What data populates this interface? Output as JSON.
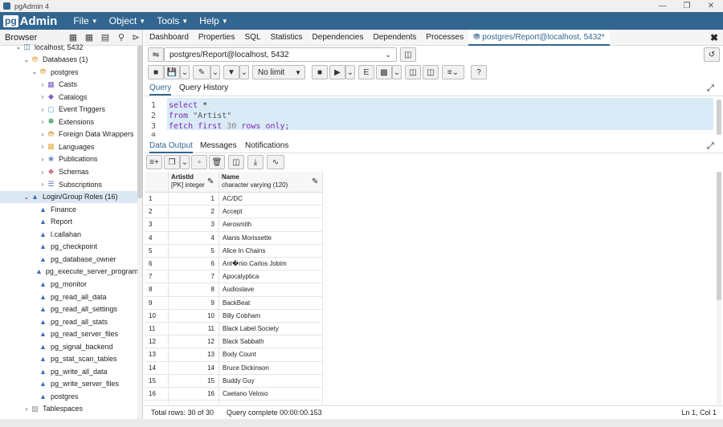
{
  "window": {
    "title": "pgAdmin 4"
  },
  "menubar": {
    "logo_pg": "pg",
    "logo_admin": "Admin",
    "items": [
      "File",
      "Object",
      "Tools",
      "Help"
    ]
  },
  "browser": {
    "label": "Browser"
  },
  "tree": [
    {
      "label": "localhost, 5432",
      "level": 0,
      "icon": "server-icon",
      "toggle": "v"
    },
    {
      "label": "Databases (1)",
      "level": 1,
      "icon": "databases-icon",
      "toggle": "v"
    },
    {
      "label": "postgres",
      "level": 2,
      "icon": "database-icon",
      "toggle": "v"
    },
    {
      "label": "Casts",
      "level": 3,
      "icon": "casts-icon",
      "toggle": ">"
    },
    {
      "label": "Catalogs",
      "level": 3,
      "icon": "catalogs-icon",
      "toggle": ">"
    },
    {
      "label": "Event Triggers",
      "level": 3,
      "icon": "event-triggers-icon",
      "toggle": ">"
    },
    {
      "label": "Extensions",
      "level": 3,
      "icon": "extensions-icon",
      "toggle": ">"
    },
    {
      "label": "Foreign Data Wrappers",
      "level": 3,
      "icon": "foreign-data-wrappers-icon",
      "toggle": ">"
    },
    {
      "label": "Languages",
      "level": 3,
      "icon": "languages-icon",
      "toggle": ">"
    },
    {
      "label": "Publications",
      "level": 3,
      "icon": "publications-icon",
      "toggle": ">"
    },
    {
      "label": "Schemas",
      "level": 3,
      "icon": "schemas-icon",
      "toggle": ">"
    },
    {
      "label": "Subscriptions",
      "level": 3,
      "icon": "subscriptions-icon",
      "toggle": ">"
    },
    {
      "label": "Login/Group Roles (16)",
      "level": 1,
      "icon": "roles-icon",
      "toggle": "v",
      "selected": true
    },
    {
      "label": "Finance",
      "level": 2,
      "icon": "role-icon",
      "toggle": ""
    },
    {
      "label": "Report",
      "level": 2,
      "icon": "role-icon",
      "toggle": ""
    },
    {
      "label": "l.callahan",
      "level": 2,
      "icon": "role-icon",
      "toggle": ""
    },
    {
      "label": "pg_checkpoint",
      "level": 2,
      "icon": "role-icon",
      "toggle": ""
    },
    {
      "label": "pg_database_owner",
      "level": 2,
      "icon": "role-icon",
      "toggle": ""
    },
    {
      "label": "pg_execute_server_program",
      "level": 2,
      "icon": "role-icon",
      "toggle": ""
    },
    {
      "label": "pg_monitor",
      "level": 2,
      "icon": "role-icon",
      "toggle": ""
    },
    {
      "label": "pg_read_all_data",
      "level": 2,
      "icon": "role-icon",
      "toggle": ""
    },
    {
      "label": "pg_read_all_settings",
      "level": 2,
      "icon": "role-icon",
      "toggle": ""
    },
    {
      "label": "pg_read_all_stats",
      "level": 2,
      "icon": "role-icon",
      "toggle": ""
    },
    {
      "label": "pg_read_server_files",
      "level": 2,
      "icon": "role-icon",
      "toggle": ""
    },
    {
      "label": "pg_signal_backend",
      "level": 2,
      "icon": "role-icon",
      "toggle": ""
    },
    {
      "label": "pg_stat_scan_tables",
      "level": 2,
      "icon": "role-icon",
      "toggle": ""
    },
    {
      "label": "pg_write_all_data",
      "level": 2,
      "icon": "role-icon",
      "toggle": ""
    },
    {
      "label": "pg_write_server_files",
      "level": 2,
      "icon": "role-icon",
      "toggle": ""
    },
    {
      "label": "postgres",
      "level": 2,
      "icon": "role-icon",
      "toggle": ""
    },
    {
      "label": "Tablespaces",
      "level": 1,
      "icon": "tablespaces-icon",
      "toggle": ">"
    }
  ],
  "main_tabs": [
    "Dashboard",
    "Properties",
    "SQL",
    "Statistics",
    "Dependencies",
    "Dependents",
    "Processes",
    "postgres/Report@localhost, 5432*"
  ],
  "connection": {
    "value": "postgres/Report@localhost, 5432"
  },
  "limit": {
    "value": "No limit"
  },
  "query_tabs": [
    "Query",
    "Query History"
  ],
  "editor": {
    "lines": [
      "select *",
      "from \"Artist\"",
      "fetch first 30 rows only;",
      ""
    ]
  },
  "result_tabs": [
    "Data Output",
    "Messages",
    "Notifications"
  ],
  "grid": {
    "columns": [
      {
        "name": "ArtistId",
        "type": "[PK] integer"
      },
      {
        "name": "Name",
        "type": "character varying (120)"
      }
    ],
    "rows": [
      {
        "n": "1",
        "id": "1",
        "name": "AC/DC"
      },
      {
        "n": "2",
        "id": "2",
        "name": "Accept"
      },
      {
        "n": "3",
        "id": "3",
        "name": "Aerosmith"
      },
      {
        "n": "4",
        "id": "4",
        "name": "Alanis Morissette"
      },
      {
        "n": "5",
        "id": "5",
        "name": "Alice In Chains"
      },
      {
        "n": "6",
        "id": "6",
        "name": "Ant�nio Carlos Jobim"
      },
      {
        "n": "7",
        "id": "7",
        "name": "Apocalyptica"
      },
      {
        "n": "8",
        "id": "8",
        "name": "Audioslave"
      },
      {
        "n": "9",
        "id": "9",
        "name": "BackBeat"
      },
      {
        "n": "10",
        "id": "10",
        "name": "Billy Cobham"
      },
      {
        "n": "11",
        "id": "11",
        "name": "Black Label Society"
      },
      {
        "n": "12",
        "id": "12",
        "name": "Black Sabbath"
      },
      {
        "n": "13",
        "id": "13",
        "name": "Body Count"
      },
      {
        "n": "14",
        "id": "14",
        "name": "Bruce Dickinson"
      },
      {
        "n": "15",
        "id": "15",
        "name": "Buddy Guy"
      },
      {
        "n": "16",
        "id": "16",
        "name": "Caetano Veloso"
      }
    ]
  },
  "status": {
    "total_rows": "Total rows: 30 of 30",
    "query_complete": "Query complete 00:00:00.153",
    "position": "Ln 1, Col 1"
  },
  "colors": {
    "brand": "#326690",
    "selection": "#dbe7f2",
    "editor_highlight": "#d9ebf7"
  }
}
